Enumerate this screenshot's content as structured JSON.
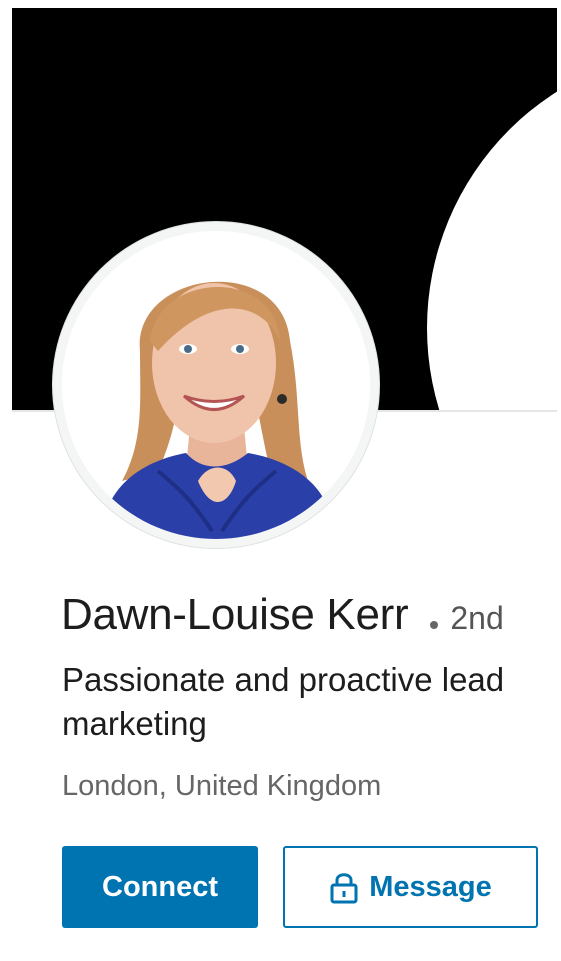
{
  "profile": {
    "name": "Dawn-Louise Kerr",
    "degree": "2nd",
    "headline_line1": "Passionate and proactive lead",
    "headline_line2": "marketing",
    "location": "London, United Kingdom"
  },
  "actions": {
    "connect_label": "Connect",
    "message_label": "Message"
  },
  "icons": {
    "message": "lock-icon"
  },
  "colors": {
    "primary": "#0073b1",
    "cover": "#000000"
  }
}
